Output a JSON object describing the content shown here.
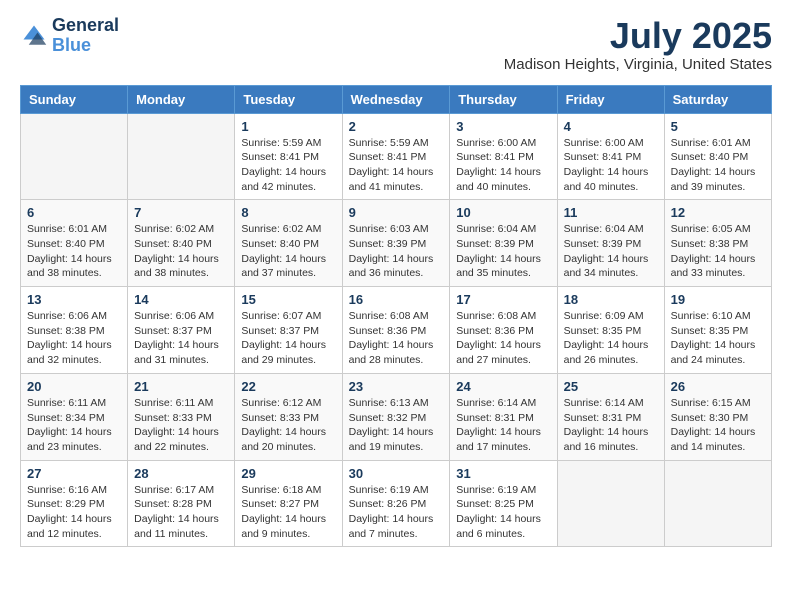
{
  "logo": {
    "line1": "General",
    "line2": "Blue"
  },
  "title": {
    "month_year": "July 2025",
    "location": "Madison Heights, Virginia, United States"
  },
  "weekdays": [
    "Sunday",
    "Monday",
    "Tuesday",
    "Wednesday",
    "Thursday",
    "Friday",
    "Saturday"
  ],
  "weeks": [
    [
      {
        "day": "",
        "info": ""
      },
      {
        "day": "",
        "info": ""
      },
      {
        "day": "1",
        "info": "Sunrise: 5:59 AM\nSunset: 8:41 PM\nDaylight: 14 hours and 42 minutes."
      },
      {
        "day": "2",
        "info": "Sunrise: 5:59 AM\nSunset: 8:41 PM\nDaylight: 14 hours and 41 minutes."
      },
      {
        "day": "3",
        "info": "Sunrise: 6:00 AM\nSunset: 8:41 PM\nDaylight: 14 hours and 40 minutes."
      },
      {
        "day": "4",
        "info": "Sunrise: 6:00 AM\nSunset: 8:41 PM\nDaylight: 14 hours and 40 minutes."
      },
      {
        "day": "5",
        "info": "Sunrise: 6:01 AM\nSunset: 8:40 PM\nDaylight: 14 hours and 39 minutes."
      }
    ],
    [
      {
        "day": "6",
        "info": "Sunrise: 6:01 AM\nSunset: 8:40 PM\nDaylight: 14 hours and 38 minutes."
      },
      {
        "day": "7",
        "info": "Sunrise: 6:02 AM\nSunset: 8:40 PM\nDaylight: 14 hours and 38 minutes."
      },
      {
        "day": "8",
        "info": "Sunrise: 6:02 AM\nSunset: 8:40 PM\nDaylight: 14 hours and 37 minutes."
      },
      {
        "day": "9",
        "info": "Sunrise: 6:03 AM\nSunset: 8:39 PM\nDaylight: 14 hours and 36 minutes."
      },
      {
        "day": "10",
        "info": "Sunrise: 6:04 AM\nSunset: 8:39 PM\nDaylight: 14 hours and 35 minutes."
      },
      {
        "day": "11",
        "info": "Sunrise: 6:04 AM\nSunset: 8:39 PM\nDaylight: 14 hours and 34 minutes."
      },
      {
        "day": "12",
        "info": "Sunrise: 6:05 AM\nSunset: 8:38 PM\nDaylight: 14 hours and 33 minutes."
      }
    ],
    [
      {
        "day": "13",
        "info": "Sunrise: 6:06 AM\nSunset: 8:38 PM\nDaylight: 14 hours and 32 minutes."
      },
      {
        "day": "14",
        "info": "Sunrise: 6:06 AM\nSunset: 8:37 PM\nDaylight: 14 hours and 31 minutes."
      },
      {
        "day": "15",
        "info": "Sunrise: 6:07 AM\nSunset: 8:37 PM\nDaylight: 14 hours and 29 minutes."
      },
      {
        "day": "16",
        "info": "Sunrise: 6:08 AM\nSunset: 8:36 PM\nDaylight: 14 hours and 28 minutes."
      },
      {
        "day": "17",
        "info": "Sunrise: 6:08 AM\nSunset: 8:36 PM\nDaylight: 14 hours and 27 minutes."
      },
      {
        "day": "18",
        "info": "Sunrise: 6:09 AM\nSunset: 8:35 PM\nDaylight: 14 hours and 26 minutes."
      },
      {
        "day": "19",
        "info": "Sunrise: 6:10 AM\nSunset: 8:35 PM\nDaylight: 14 hours and 24 minutes."
      }
    ],
    [
      {
        "day": "20",
        "info": "Sunrise: 6:11 AM\nSunset: 8:34 PM\nDaylight: 14 hours and 23 minutes."
      },
      {
        "day": "21",
        "info": "Sunrise: 6:11 AM\nSunset: 8:33 PM\nDaylight: 14 hours and 22 minutes."
      },
      {
        "day": "22",
        "info": "Sunrise: 6:12 AM\nSunset: 8:33 PM\nDaylight: 14 hours and 20 minutes."
      },
      {
        "day": "23",
        "info": "Sunrise: 6:13 AM\nSunset: 8:32 PM\nDaylight: 14 hours and 19 minutes."
      },
      {
        "day": "24",
        "info": "Sunrise: 6:14 AM\nSunset: 8:31 PM\nDaylight: 14 hours and 17 minutes."
      },
      {
        "day": "25",
        "info": "Sunrise: 6:14 AM\nSunset: 8:31 PM\nDaylight: 14 hours and 16 minutes."
      },
      {
        "day": "26",
        "info": "Sunrise: 6:15 AM\nSunset: 8:30 PM\nDaylight: 14 hours and 14 minutes."
      }
    ],
    [
      {
        "day": "27",
        "info": "Sunrise: 6:16 AM\nSunset: 8:29 PM\nDaylight: 14 hours and 12 minutes."
      },
      {
        "day": "28",
        "info": "Sunrise: 6:17 AM\nSunset: 8:28 PM\nDaylight: 14 hours and 11 minutes."
      },
      {
        "day": "29",
        "info": "Sunrise: 6:18 AM\nSunset: 8:27 PM\nDaylight: 14 hours and 9 minutes."
      },
      {
        "day": "30",
        "info": "Sunrise: 6:19 AM\nSunset: 8:26 PM\nDaylight: 14 hours and 7 minutes."
      },
      {
        "day": "31",
        "info": "Sunrise: 6:19 AM\nSunset: 8:25 PM\nDaylight: 14 hours and 6 minutes."
      },
      {
        "day": "",
        "info": ""
      },
      {
        "day": "",
        "info": ""
      }
    ]
  ]
}
